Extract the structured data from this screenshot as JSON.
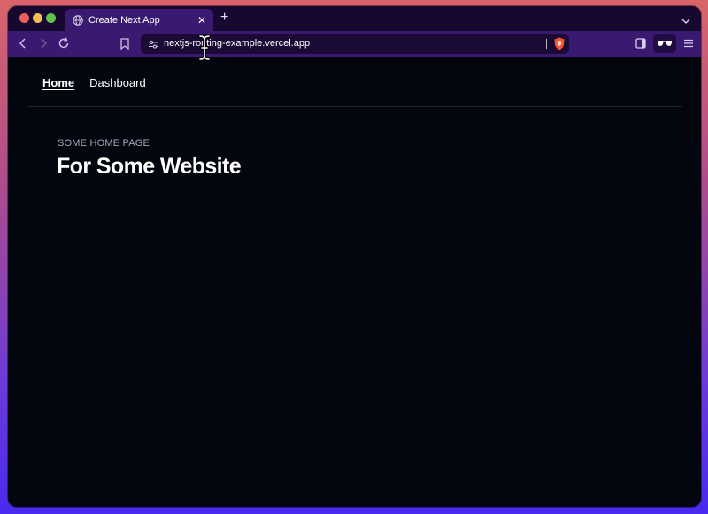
{
  "browser": {
    "tab": {
      "title": "Create Next App"
    },
    "url": "nextjs-routing-example.vercel.app"
  },
  "nav": {
    "items": [
      {
        "label": "Home",
        "active": true
      },
      {
        "label": "Dashboard",
        "active": false
      }
    ]
  },
  "hero": {
    "eyebrow": "SOME HOME PAGE",
    "title": "For Some Website"
  },
  "colors": {
    "tab_bar": "#17082f",
    "toolbar": "#3a1a70",
    "page_bg": "#03060f",
    "eyebrow": "#a4a9b6",
    "brave_orange": "#fb542b"
  },
  "icons": [
    "globe-icon",
    "close-icon",
    "plus-icon",
    "chevron-down-icon",
    "back-icon",
    "forward-icon",
    "reload-icon",
    "bookmark-icon",
    "site-settings-icon",
    "brave-shield-icon",
    "sidebar-icon",
    "glasses-icon",
    "menu-icon",
    "text-cursor-icon"
  ]
}
